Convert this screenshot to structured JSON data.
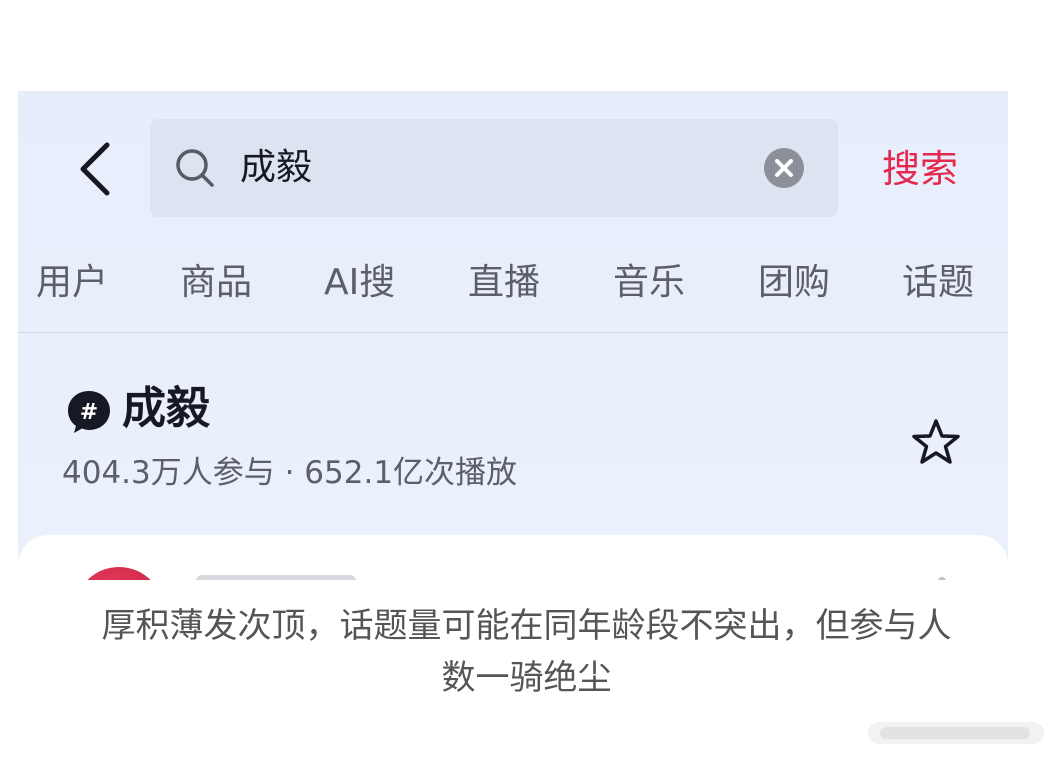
{
  "search": {
    "query": "成毅",
    "button_label": "搜索"
  },
  "tabs": [
    {
      "label": "用户"
    },
    {
      "label": "商品"
    },
    {
      "label": "AI搜"
    },
    {
      "label": "直播"
    },
    {
      "label": "音乐"
    },
    {
      "label": "团购"
    },
    {
      "label": "话题"
    }
  ],
  "topic": {
    "title": "成毅",
    "stats": "404.3万人参与 · 652.1亿次播放"
  },
  "caption": {
    "line1": "厚积薄发次顶，话题量可能在同年龄段不突出，但参与人",
    "line2": "数一骑绝尘"
  },
  "colors": {
    "accent": "#e4284e",
    "background": "#e8eefb"
  },
  "icons": {
    "back": "chevron-left-icon",
    "search": "search-icon",
    "clear": "clear-icon",
    "topic": "hashtag-icon",
    "favorite": "star-icon"
  }
}
